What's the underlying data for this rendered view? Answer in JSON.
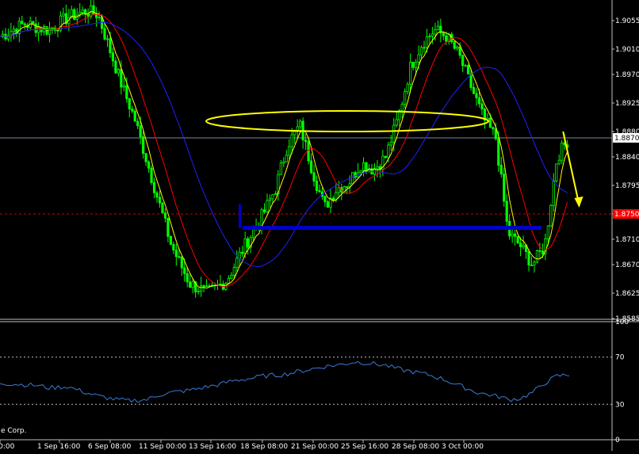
{
  "chart_data": [
    {
      "type": "candlestick",
      "x_labels": [
        "Aug 00:00",
        "1 Sep 16:00",
        "6 Sep 08:00",
        "11 Sep 00:00",
        "13 Sep 16:00",
        "18 Sep 08:00",
        "21 Sep 00:00",
        "25 Sep 16:00",
        "28 Sep 08:00",
        "3 Oct 00:00"
      ],
      "y_ticks": [
        "1.9055",
        "1.9010",
        "1.8970",
        "1.8925",
        "1.8880",
        "1.8840",
        "1.8795",
        "1.8750",
        "1.8710",
        "1.8670",
        "1.8625",
        "1.8585"
      ],
      "ylim": [
        1.8585,
        1.9085
      ],
      "current_price": {
        "label": "1.8870",
        "value": 1.887
      },
      "marked_level": {
        "label": "1.8750",
        "value": 1.875
      },
      "support_level": 1.8728,
      "price_path": [
        [
          0,
          1.903
        ],
        [
          4,
          1.905
        ],
        [
          8,
          1.904
        ],
        [
          11,
          1.906
        ],
        [
          14,
          1.907
        ],
        [
          16,
          1.9065
        ],
        [
          20,
          1.895
        ],
        [
          22,
          1.89
        ],
        [
          25,
          1.88
        ],
        [
          28,
          1.87
        ],
        [
          31,
          1.864
        ],
        [
          34,
          1.8625
        ],
        [
          37,
          1.8645
        ],
        [
          40,
          1.87
        ],
        [
          43,
          1.875
        ],
        [
          45,
          1.879
        ],
        [
          47,
          1.886
        ],
        [
          49,
          1.889
        ],
        [
          51,
          1.882
        ],
        [
          53,
          1.876
        ],
        [
          55,
          1.879
        ],
        [
          57,
          1.88
        ],
        [
          59,
          1.883
        ],
        [
          61,
          1.882
        ],
        [
          63,
          1.884
        ],
        [
          65,
          1.89
        ],
        [
          67,
          1.898
        ],
        [
          69,
          1.902
        ],
        [
          71,
          1.904
        ],
        [
          73,
          1.903
        ],
        [
          75,
          1.9
        ],
        [
          77,
          1.895
        ],
        [
          79,
          1.89
        ],
        [
          81,
          1.887
        ],
        [
          83,
          1.872
        ],
        [
          85,
          1.87
        ],
        [
          87,
          1.867
        ],
        [
          89,
          1.87
        ],
        [
          91,
          1.884
        ],
        [
          93,
          1.887
        ]
      ],
      "indicators": [
        {
          "type": "moving-average",
          "color": "#ffff00"
        },
        {
          "type": "moving-average",
          "color": "#ff0000"
        },
        {
          "type": "moving-average",
          "color": "#2020ff"
        }
      ],
      "annotations": [
        {
          "type": "ellipse",
          "color": "#ffff00"
        },
        {
          "type": "arrow",
          "color": "#ffff00",
          "from": [
            92,
            1.888
          ],
          "to": [
            94.5,
            1.876
          ]
        },
        {
          "type": "horizontal-line",
          "color": "#0000cc"
        }
      ],
      "colors": {
        "candles": "#00ff00",
        "background": "#000000",
        "axis_text": "#ffffff"
      }
    },
    {
      "type": "line",
      "name": "oscillator",
      "y_ticks": [
        "100",
        "70",
        "30",
        "0"
      ],
      "ylim": [
        0,
        100
      ],
      "levels": [
        70,
        30
      ],
      "color": "#3a7bd5",
      "values": [
        [
          0,
          48
        ],
        [
          3,
          47
        ],
        [
          6,
          46
        ],
        [
          8,
          44
        ],
        [
          11,
          45
        ],
        [
          14,
          40
        ],
        [
          16,
          37
        ],
        [
          19,
          34
        ],
        [
          21,
          33
        ],
        [
          24,
          34
        ],
        [
          26,
          38
        ],
        [
          28,
          40
        ],
        [
          31,
          42
        ],
        [
          33,
          44
        ],
        [
          36,
          47
        ],
        [
          38,
          50
        ],
        [
          41,
          52
        ],
        [
          43,
          54
        ],
        [
          46,
          55
        ],
        [
          48,
          57
        ],
        [
          51,
          60
        ],
        [
          53,
          62
        ],
        [
          56,
          64
        ],
        [
          58,
          66
        ],
        [
          60,
          65
        ],
        [
          63,
          63
        ],
        [
          65,
          60
        ],
        [
          67,
          58
        ],
        [
          70,
          55
        ],
        [
          72,
          52
        ],
        [
          74,
          48
        ],
        [
          76,
          44
        ],
        [
          78,
          40
        ],
        [
          80,
          38
        ],
        [
          82,
          36
        ],
        [
          83,
          34
        ],
        [
          85,
          35
        ],
        [
          87,
          40
        ],
        [
          89,
          48
        ],
        [
          91,
          54
        ],
        [
          93,
          55
        ]
      ]
    }
  ],
  "copyright_text": "e Corp."
}
